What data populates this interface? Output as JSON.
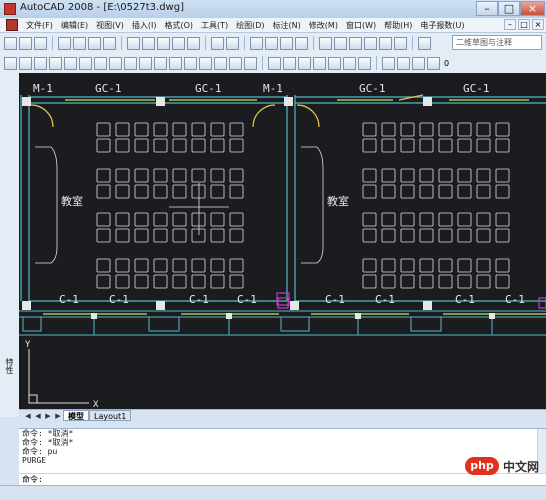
{
  "window": {
    "title": "AutoCAD 2008 - [E:\\0527t3.dwg]",
    "controls": [
      "–",
      "□",
      "×"
    ]
  },
  "menubar": {
    "items": [
      "文件(F)",
      "编辑(E)",
      "视图(V)",
      "插入(I)",
      "格式(O)",
      "工具(T)",
      "绘图(D)",
      "标注(N)",
      "修改(M)",
      "窗口(W)",
      "帮助(H)",
      "电子报数(U)"
    ],
    "doc_controls": [
      "–",
      "□",
      "×"
    ]
  },
  "toolbar": {
    "workspace": "二维草图与注释",
    "layer_value": "0"
  },
  "drawing": {
    "labels": {
      "m1_left": "M-1",
      "gc1_a": "GC-1",
      "gc1_b": "GC-1",
      "m1_mid": "M-1",
      "gc1_c": "GC-1",
      "gc1_d": "GC-1",
      "classroom_left": "教室",
      "classroom_right": "教室",
      "c1_a": "C-1",
      "c1_b": "C-1",
      "c1_c": "C-1",
      "c1_d": "C-1",
      "c1_e": "C-1",
      "c1_f": "C-1",
      "c1_g": "C-1",
      "c1_h": "C-1",
      "ucs_x": "X",
      "ucs_y": "Y"
    },
    "colors": {
      "background": "#1b1c1f",
      "wall": "#56b8c4",
      "desk": "#e0e0e0",
      "window": "#c8e06a",
      "door": "#e3c24a",
      "column": "#e6e6e6",
      "magenta": "#c23bc0"
    }
  },
  "left_panel": {
    "label": "特性"
  },
  "tabs": {
    "nav": [
      "◀",
      "◀",
      "▶",
      "▶"
    ],
    "model": "模型",
    "layout": "Layout1"
  },
  "command": {
    "history": [
      "命令: *取消*",
      "命令: *取消*",
      "命令: pu",
      "PURGE"
    ],
    "prompt": "命令:"
  },
  "watermark": {
    "mark": "php",
    "text": "中文网"
  }
}
